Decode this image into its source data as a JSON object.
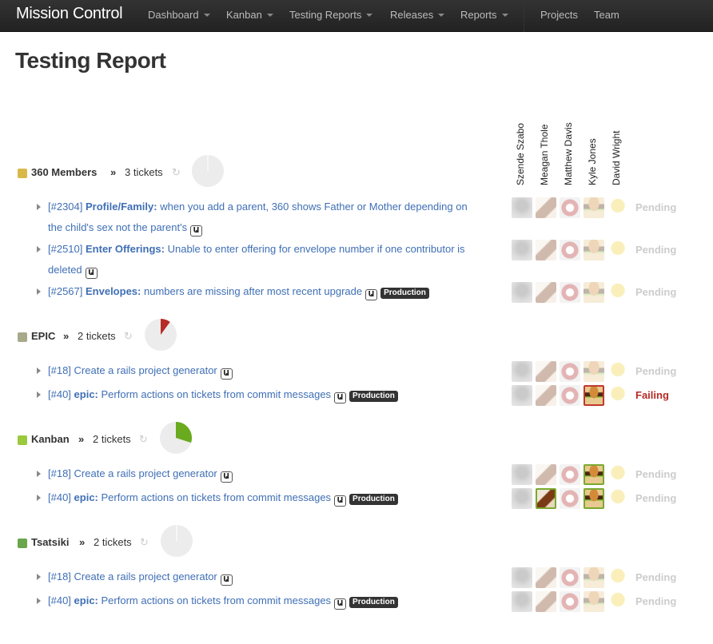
{
  "navbar": {
    "brand": "Mission Control",
    "items": [
      {
        "label": "Dashboard",
        "dropdown": true
      },
      {
        "label": "Kanban",
        "dropdown": true
      },
      {
        "label": "Testing Reports",
        "dropdown": true
      },
      {
        "label": "Releases",
        "dropdown": true
      },
      {
        "label": "Reports",
        "dropdown": true
      },
      {
        "label": "Projects",
        "dropdown": false
      },
      {
        "label": "Team",
        "dropdown": false
      }
    ]
  },
  "page": {
    "title": "Testing Report"
  },
  "people": [
    "Szende Szabo",
    "Meagan Thole",
    "Matthew Davis",
    "Kyle Jones",
    "David Wright"
  ],
  "badges": {
    "u": "Ա",
    "production": "Production"
  },
  "groups": [
    {
      "name": "360 Members",
      "sep": "»",
      "count": "3 tickets",
      "color": "#d9b84a",
      "failing_fraction": 0,
      "pie_color": "#b52b27",
      "tickets": [
        {
          "id": "[#2304]",
          "area": "Profile/Family:",
          "text": "when you add a parent, 360 shows Father or Mother depending on the child's sex not the parent's",
          "production": false,
          "status": "Pending"
        },
        {
          "id": "[#2510]",
          "area": "Enter Offerings:",
          "text": "Unable to enter offering for envelope number if one contributor is deleted",
          "production": false,
          "status": "Pending"
        },
        {
          "id": "[#2567]",
          "area": "Envelopes:",
          "text": "numbers are missing after most recent upgrade",
          "production": true,
          "status": "Pending"
        }
      ]
    },
    {
      "name": "EPIC",
      "sep": "»",
      "count": "2 tickets",
      "color": "#a8a98a",
      "failing_fraction": 0.1,
      "pie_color": "#b52b27",
      "tickets": [
        {
          "id": "[#18]",
          "area": "",
          "text": "Create a rails project generator",
          "production": false,
          "status": "Pending"
        },
        {
          "id": "[#40]",
          "area": "epic:",
          "text": "Perform actions on tickets from commit messages",
          "production": true,
          "status": "Failing"
        }
      ]
    },
    {
      "name": "Kanban",
      "sep": "»",
      "count": "2 tickets",
      "color": "#9ac93d",
      "failing_fraction": 0.3,
      "pie_color": "#6aaa1e",
      "tickets": [
        {
          "id": "[#18]",
          "area": "",
          "text": "Create a rails project generator",
          "production": false,
          "status": "Pending"
        },
        {
          "id": "[#40]",
          "area": "epic:",
          "text": "Perform actions on tickets from commit messages",
          "production": true,
          "status": "Pending"
        }
      ]
    },
    {
      "name": "Tsatsiki",
      "sep": "»",
      "count": "2 tickets",
      "color": "#6aa64a",
      "failing_fraction": 0,
      "pie_color": "#6aaa1e",
      "tickets": [
        {
          "id": "[#18]",
          "area": "",
          "text": "Create a rails project generator",
          "production": false,
          "status": "Pending"
        },
        {
          "id": "[#40]",
          "area": "epic:",
          "text": "Perform actions on tickets from commit messages",
          "production": true,
          "status": "Pending"
        }
      ]
    }
  ]
}
